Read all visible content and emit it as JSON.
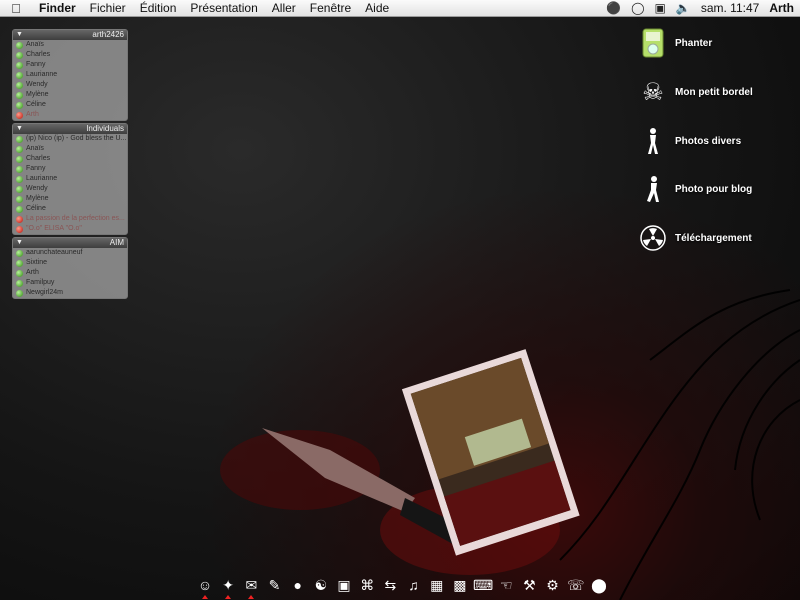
{
  "menubar": {
    "app": "Finder",
    "menus": [
      "Fichier",
      "Édition",
      "Présentation",
      "Aller",
      "Fenêtre",
      "Aide"
    ],
    "clock": "sam. 11:47",
    "user": "Arth"
  },
  "buddy_lists": [
    {
      "title": "arth2426",
      "buddies": [
        {
          "name": "Anaïs",
          "status": "green"
        },
        {
          "name": "Charles",
          "status": "green"
        },
        {
          "name": "Fanny",
          "status": "green"
        },
        {
          "name": "Laurianne",
          "status": "green"
        },
        {
          "name": "Wendy",
          "status": "green"
        },
        {
          "name": "Mylène",
          "status": "green"
        },
        {
          "name": "Céline",
          "status": "green"
        },
        {
          "name": "Arth",
          "status": "red"
        }
      ]
    },
    {
      "title": "Individuals",
      "buddies": [
        {
          "name": "(ip) Nico (ip) - God bless the U...",
          "status": "green"
        },
        {
          "name": "Anaïs",
          "status": "green"
        },
        {
          "name": "Charles",
          "status": "green"
        },
        {
          "name": "Fanny",
          "status": "green"
        },
        {
          "name": "Laurianne",
          "status": "green"
        },
        {
          "name": "Wendy",
          "status": "green"
        },
        {
          "name": "Mylène",
          "status": "green"
        },
        {
          "name": "Céline",
          "status": "green"
        },
        {
          "name": "La passion de la perfection es...",
          "status": "red"
        },
        {
          "name": "\"O.o\" ELISA \"O.o\"",
          "status": "red"
        }
      ]
    },
    {
      "title": "AIM",
      "buddies": [
        {
          "name": "aarunchateauneuf",
          "status": "green"
        },
        {
          "name": "Sixtine",
          "status": "green"
        },
        {
          "name": "Arth",
          "status": "green"
        },
        {
          "name": "Familpuy",
          "status": "green"
        },
        {
          "name": "Newgirl24m",
          "status": "green"
        }
      ]
    }
  ],
  "desktop_icons": [
    {
      "label": "Phanter",
      "icon": "ipod-icon"
    },
    {
      "label": "Mon petit bordel",
      "icon": "skull-icon"
    },
    {
      "label": "Photos divers",
      "icon": "silhouette-icon"
    },
    {
      "label": "Photo pour blog",
      "icon": "silhouette-icon"
    },
    {
      "label": "Téléchargement",
      "icon": "radiation-icon"
    }
  ],
  "dock": [
    "smiley-icon",
    "bird-icon",
    "mail-icon",
    "pencil-icon",
    "chat-icon",
    "finder-icon",
    "monitor-icon",
    "command-icon",
    "arrows-icon",
    "music-icon",
    "photo-icon",
    "clapper-icon",
    "stamp-icon",
    "gun-icon",
    "gamepad-icon",
    "gears-icon",
    "phone-icon",
    "circle-icon"
  ],
  "colors": {
    "background": "#111111",
    "accent_red": "#7a1010"
  }
}
